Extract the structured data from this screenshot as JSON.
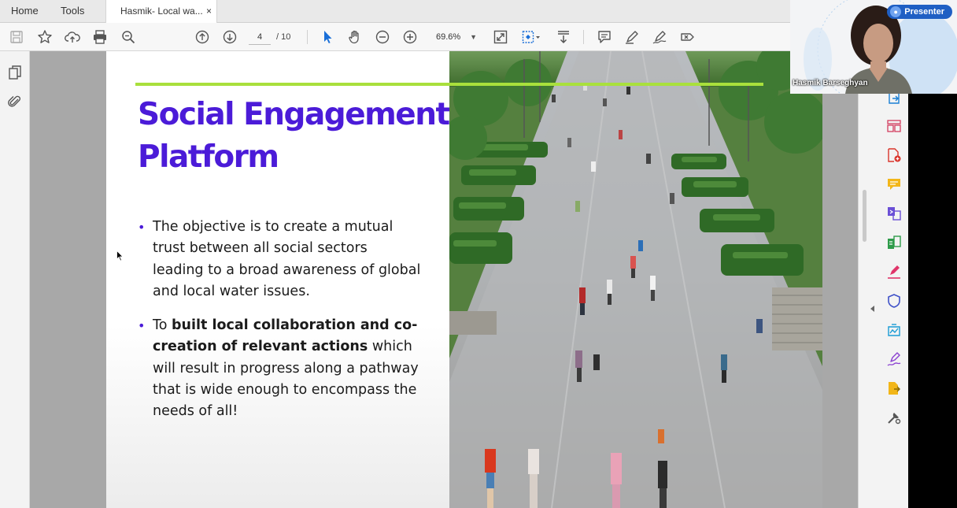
{
  "app": {
    "top_tabs": [
      "Home",
      "Tools"
    ],
    "document_tab": {
      "title": "Hasmik- Local wa...",
      "close": "×"
    }
  },
  "toolbar": {
    "page_current": "4",
    "page_total": "/ 10",
    "zoom": "69.6%"
  },
  "slide": {
    "title": "Social Engagement Platform",
    "bullet_marker": "•",
    "bullet1": "The objective is to create a mutual trust between all social sectors leading to a broad awareness of global and local water issues.",
    "bullet2_prefix": "To ",
    "bullet2_bold": "built local collaboration and co-creation of relevant actions",
    "bullet2_rest": " which will result in progress along a pathway that is wide enough to encompass the needs of all!",
    "accent_color": "#a9e03c",
    "title_color": "#4b1bd8"
  },
  "presenter": {
    "badge": "Presenter",
    "name": "Hasmik Barseghyan"
  },
  "right_tools": [
    "export-pdf-icon",
    "organize-pages-icon",
    "create-pdf-icon",
    "comment-icon",
    "combine-files-icon",
    "edit-pdf-icon",
    "fill-sign-icon",
    "protect-icon",
    "optimize-icon",
    "request-signature-icon",
    "send-review-icon",
    "more-tools-icon"
  ]
}
